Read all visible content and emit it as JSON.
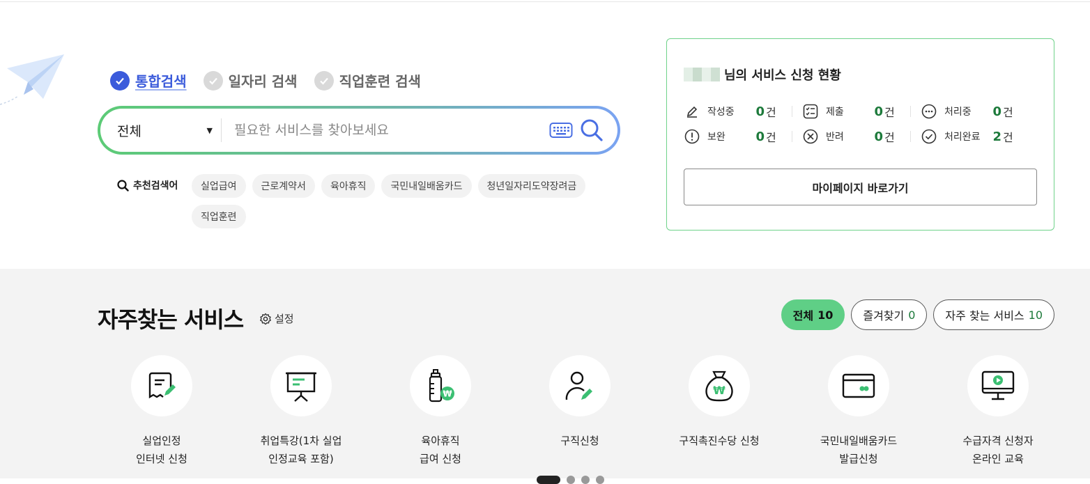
{
  "search": {
    "tabs": [
      {
        "label": "통합검색",
        "active": true
      },
      {
        "label": "일자리 검색",
        "active": false
      },
      {
        "label": "직업훈련 검색",
        "active": false
      }
    ],
    "scope": "전체",
    "placeholder": "필요한 서비스를 찾아보세요"
  },
  "recommend": {
    "label": "추천검색어",
    "keywords": [
      "실업급여",
      "근로계약서",
      "육아휴직",
      "국민내일배움카드",
      "청년일자리도약장려금",
      "직업훈련"
    ]
  },
  "status": {
    "title_suffix": "님의 서비스 신청 현황",
    "items": [
      {
        "label": "작성중",
        "count": "0",
        "unit": "건",
        "icon": "pencil-icon"
      },
      {
        "label": "제출",
        "count": "0",
        "unit": "건",
        "icon": "checklist-icon"
      },
      {
        "label": "처리중",
        "count": "0",
        "unit": "건",
        "icon": "more-icon"
      },
      {
        "label": "보완",
        "count": "0",
        "unit": "건",
        "icon": "alert-icon"
      },
      {
        "label": "반려",
        "count": "0",
        "unit": "건",
        "icon": "x-circle-icon"
      },
      {
        "label": "처리완료",
        "count": "2",
        "unit": "건",
        "icon": "check-circle-icon"
      }
    ],
    "mypage_button": "마이페이지 바로가기"
  },
  "favorites": {
    "title": "자주찾는 서비스",
    "settings": "설정",
    "filters": [
      {
        "label": "전체",
        "count": "10",
        "active": true
      },
      {
        "label": "즐겨찾기",
        "count": "0",
        "active": false
      },
      {
        "label": "자주 찾는 서비스",
        "count": "10",
        "active": false
      }
    ],
    "services": [
      {
        "line1": "실업인정",
        "line2": "인터넷 신청",
        "icon": "receipt-pen-icon"
      },
      {
        "line1": "취업특강(1차 실업",
        "line2": "인정교육 포함)",
        "icon": "presentation-board-icon"
      },
      {
        "line1": "육아휴직",
        "line2": "급여 신청",
        "icon": "baby-bottle-won-icon"
      },
      {
        "line1": "구직신청",
        "line2": "",
        "icon": "person-pen-icon"
      },
      {
        "line1": "구직촉진수당 신청",
        "line2": "",
        "icon": "money-bag-won-icon"
      },
      {
        "line1": "국민내일배움카드",
        "line2": "발급신청",
        "icon": "card-icon"
      },
      {
        "line1": "수급자격 신청자",
        "line2": "온라인 교육",
        "icon": "monitor-play-icon"
      }
    ]
  },
  "colors": {
    "accent_green": "#5fcf86",
    "count_green": "#1d7a3b",
    "tab_blue": "#3b5bdb"
  }
}
